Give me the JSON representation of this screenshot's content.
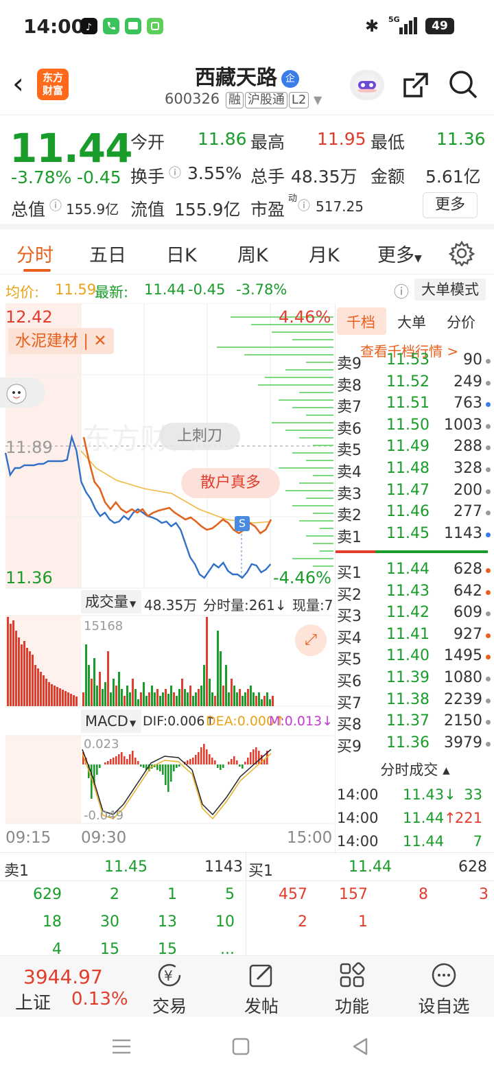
{
  "status": {
    "time": "14:00",
    "battery": "49",
    "net": "5G"
  },
  "header": {
    "stock_name": "西藏天路",
    "badge": "企",
    "code": "600326",
    "tags": [
      "融",
      "沪股通",
      "L2"
    ],
    "brand": {
      "line1": "东方",
      "line2": "财富"
    }
  },
  "quote": {
    "price": "11.44",
    "change_pct": "-3.78%",
    "change": "-0.45",
    "open_label": "今开",
    "open": "11.86",
    "high_label": "最高",
    "high": "11.95",
    "low_label": "最低",
    "low": "11.36",
    "turnover_label": "换手",
    "turnover": "3.55%",
    "volume_label": "总手",
    "volume": "48.35万",
    "amount_label": "金额",
    "amount": "5.61亿",
    "mktcap_label": "总值",
    "mktcap": "155.9亿",
    "float_label": "流值",
    "float": "155.9亿",
    "pe_label": "市盈",
    "pe_sup": "动",
    "pe": "517.25",
    "more_btn": "更多"
  },
  "tabs": [
    "分时",
    "五日",
    "日K",
    "周K",
    "月K",
    "更多"
  ],
  "info": {
    "avg_label": "均价:",
    "avg": "11.59",
    "latest_label": "最新:",
    "latest": "11.44",
    "chg": "-0.45",
    "chg_pct": "-3.78%",
    "mode_btn": "大单模式"
  },
  "chart": {
    "top_price": "12.42",
    "mid_price": "11.89",
    "low_price": "11.36",
    "top_pct": "4.46%",
    "low_pct": "-4.46%",
    "sector_tag": "水泥建材 | ✕",
    "bubble1": "上刺刀",
    "bubble2": "散户真多",
    "marker": "S",
    "watermark": "东方财富",
    "vol_label": "成交量",
    "vol_total": "48.35万",
    "vol_min_label": "分时量:261↓",
    "vol_now_label": "现量:7",
    "vol_max": "15168",
    "macd_label": "MACD",
    "dif": "DIF:0.006↑",
    "dea": "DEA:0.000↑",
    "m": "M:0.013↓",
    "macd_max": "0.023",
    "macd_min": "-0.049",
    "times": [
      "09:15",
      "09:30",
      "15:00"
    ]
  },
  "book": {
    "tabs": [
      "千档",
      "大单",
      "分价"
    ],
    "link": "查看千档行情 >",
    "sells": [
      {
        "label": "卖9",
        "price": "11.53",
        "vol": "90",
        "dot": "#999999"
      },
      {
        "label": "卖8",
        "price": "11.52",
        "vol": "249",
        "dot": "#999999"
      },
      {
        "label": "卖7",
        "price": "11.51",
        "vol": "763",
        "dot": "#3a7de8"
      },
      {
        "label": "卖6",
        "price": "11.50",
        "vol": "1003",
        "dot": "#999999"
      },
      {
        "label": "卖5",
        "price": "11.49",
        "vol": "288",
        "dot": "#999999"
      },
      {
        "label": "卖4",
        "price": "11.48",
        "vol": "328",
        "dot": "#999999"
      },
      {
        "label": "卖3",
        "price": "11.47",
        "vol": "200",
        "dot": "#999999"
      },
      {
        "label": "卖2",
        "price": "11.46",
        "vol": "277",
        "dot": "#999999"
      },
      {
        "label": "卖1",
        "price": "11.45",
        "vol": "1143",
        "dot": "#3a7de8"
      }
    ],
    "buys": [
      {
        "label": "买1",
        "price": "11.44",
        "vol": "628",
        "dot": "#e8601c"
      },
      {
        "label": "买2",
        "price": "11.43",
        "vol": "642",
        "dot": "#e8601c"
      },
      {
        "label": "买3",
        "price": "11.42",
        "vol": "609",
        "dot": "#999999"
      },
      {
        "label": "买4",
        "price": "11.41",
        "vol": "927",
        "dot": "#e8601c"
      },
      {
        "label": "买5",
        "price": "11.40",
        "vol": "1495",
        "dot": "#e8601c"
      },
      {
        "label": "买6",
        "price": "11.39",
        "vol": "1080",
        "dot": "#999999"
      },
      {
        "label": "买7",
        "price": "11.38",
        "vol": "2239",
        "dot": "#999999"
      },
      {
        "label": "买8",
        "price": "11.37",
        "vol": "2150",
        "dot": "#999999"
      },
      {
        "label": "买9",
        "price": "11.36",
        "vol": "3979",
        "dot": "#999999"
      }
    ],
    "trades_title": "分时成交 ▴",
    "trades": [
      {
        "time": "14:00",
        "price": "11.43↓",
        "vol": "33"
      },
      {
        "time": "14:00",
        "price": "11.44↑",
        "vol": "221"
      },
      {
        "time": "14:00",
        "price": "11.44",
        "vol": "7"
      }
    ]
  },
  "lower": {
    "sell_label": "卖1",
    "sell_price": "11.45",
    "sell_vol": "1143",
    "buy_label": "买1",
    "buy_price": "11.44",
    "buy_vol": "628",
    "sell_rows": [
      [
        "629",
        "2",
        "1",
        "5"
      ],
      [
        "18",
        "30",
        "13",
        "10"
      ],
      [
        "4",
        "15",
        "15",
        "..."
      ]
    ],
    "buy_rows": [
      [
        "457",
        "157",
        "8",
        "3"
      ],
      [
        "2",
        "1",
        "",
        ""
      ]
    ]
  },
  "bottom": {
    "index_value": "3944.97",
    "index_name": "上证",
    "index_pct": "0.13%",
    "items": [
      "交易",
      "发帖",
      "功能",
      "设自选"
    ]
  }
}
